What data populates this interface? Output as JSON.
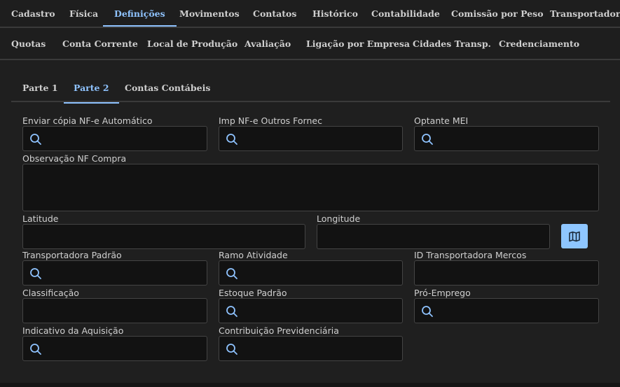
{
  "top_tabs": [
    {
      "label": "Cadastro"
    },
    {
      "label": "Física"
    },
    {
      "label": "Definições",
      "active": true
    },
    {
      "label": "Movimentos"
    },
    {
      "label": "Contatos"
    },
    {
      "label": "Histórico"
    },
    {
      "label": "Contabilidade"
    },
    {
      "label": "Comissão por Peso"
    },
    {
      "label": "Transportador"
    }
  ],
  "second_tabs": [
    {
      "label": "Quotas"
    },
    {
      "label": "Conta Corrente"
    },
    {
      "label": "Local de Produção"
    },
    {
      "label": "Avaliação"
    },
    {
      "label": "Ligação por Empresa"
    },
    {
      "label": "Cidades Transp."
    },
    {
      "label": "Credenciamento"
    }
  ],
  "sub_tabs": [
    {
      "label": "Parte 1"
    },
    {
      "label": "Parte 2",
      "active": true
    },
    {
      "label": "Contas Contábeis"
    }
  ],
  "fields": {
    "enviar_copia": {
      "label": "Enviar cópia NF-e Automático",
      "value": "",
      "icon": "search-icon"
    },
    "imp_nfe": {
      "label": "Imp NF-e Outros Fornec",
      "value": "",
      "icon": "search-icon"
    },
    "optante_mei": {
      "label": "Optante MEI",
      "value": "",
      "icon": "search-icon"
    },
    "observacao": {
      "label": "Observação NF Compra",
      "value": ""
    },
    "latitude": {
      "label": "Latitude",
      "value": ""
    },
    "longitude": {
      "label": "Longitude",
      "value": ""
    },
    "transportadora": {
      "label": "Transportadora Padrão",
      "value": "",
      "icon": "search-icon"
    },
    "ramo": {
      "label": "Ramo Atividade",
      "value": "",
      "icon": "search-icon"
    },
    "id_transp": {
      "label": "ID Transportadora Mercos",
      "value": ""
    },
    "classificacao": {
      "label": "Classificação",
      "value": ""
    },
    "estoque": {
      "label": "Estoque Padrão",
      "value": "",
      "icon": "search-icon"
    },
    "pro_emprego": {
      "label": "Pró-Emprego",
      "value": "",
      "icon": "search-icon"
    },
    "indicativo": {
      "label": "Indicativo da Aquisição",
      "value": "",
      "icon": "search-icon"
    },
    "contribuicao": {
      "label": "Contribuição Previdenciária",
      "value": "",
      "icon": "search-icon"
    }
  },
  "map_button": {
    "icon": "map-icon"
  },
  "colors": {
    "accent": "#8fc3ff",
    "background": "#1e1e1e",
    "field_bg": "#121212",
    "map_button_bg": "#8ec6ff"
  }
}
